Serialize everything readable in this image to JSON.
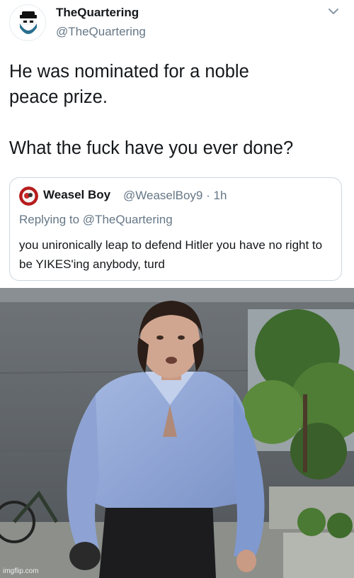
{
  "tweet": {
    "author": {
      "name": "TheQuartering",
      "handle": "@TheQuartering",
      "avatar_icon": "bearded-man-logo-icon"
    },
    "menu_icon": "chevron-down-icon",
    "text": "He was nominated for a noble\npeace prize.\n\nWhat the fuck have you ever done?",
    "quoted": {
      "author_name": "Weasel Boy",
      "handle": "@WeaselBoy9",
      "time": "· 1h",
      "avatar_icon": "weasel-avatar-icon",
      "replying_prefix": "Replying to",
      "replying_to": "@TheQuartering",
      "text": "you unironically leap to defend Hitler you have no right to be YIKES'ing anybody, turd"
    }
  },
  "photo": {
    "subject": "man-in-blue-shirt-photo",
    "watermark": "imgflip.com"
  },
  "colors": {
    "text": "#14171a",
    "secondary": "#657786",
    "border": "#ccd6dd",
    "shirt": "#8fa6d6"
  }
}
